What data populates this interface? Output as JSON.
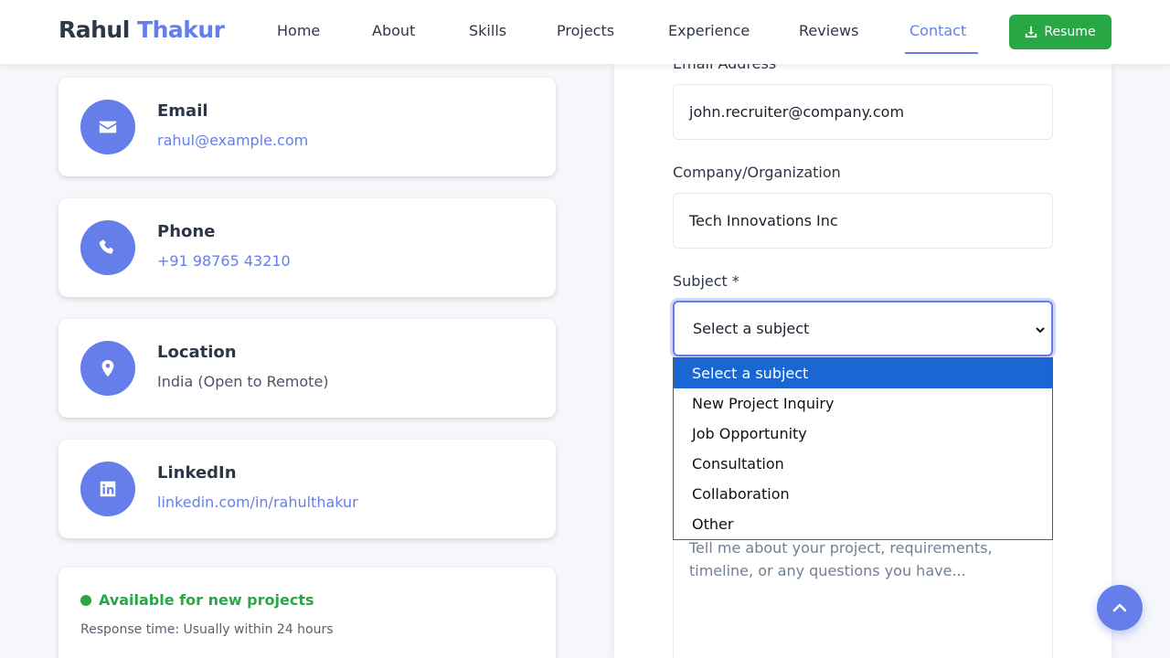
{
  "navbar": {
    "logo_first": "Rahul",
    "logo_last": "Thakur",
    "links": [
      "Home",
      "About",
      "Skills",
      "Projects",
      "Experience",
      "Reviews",
      "Contact"
    ],
    "active_link": "Contact",
    "resume_label": "Resume"
  },
  "contact_cards": [
    {
      "title": "Email",
      "value": "rahul@example.com",
      "icon": "envelope-icon"
    },
    {
      "title": "Phone",
      "value": "+91 98765 43210",
      "icon": "phone-icon"
    },
    {
      "title": "Location",
      "value": "India (Open to Remote)",
      "icon": "map-pin-icon"
    },
    {
      "title": "LinkedIn",
      "value": "linkedin.com/in/rahulthakur",
      "icon": "linkedin-icon"
    }
  ],
  "availability": {
    "status": "Available for new projects",
    "response": "Response time: Usually within 24 hours"
  },
  "form": {
    "email_label": "Email Address",
    "email_value": "john.recruiter@company.com",
    "company_label": "Company/Organization",
    "company_value": "Tech Innovations Inc",
    "subject_label": "Subject *",
    "subject_selected": "Select a subject",
    "subject_options": [
      "Select a subject",
      "New Project Inquiry",
      "Job Opportunity",
      "Consultation",
      "Collaboration",
      "Other"
    ],
    "message_placeholder": "Tell me about your project, requirements, timeline, or any questions you have..."
  },
  "colors": {
    "accent": "#667eea",
    "success": "#28a745",
    "option_highlight": "#1a66d2"
  }
}
